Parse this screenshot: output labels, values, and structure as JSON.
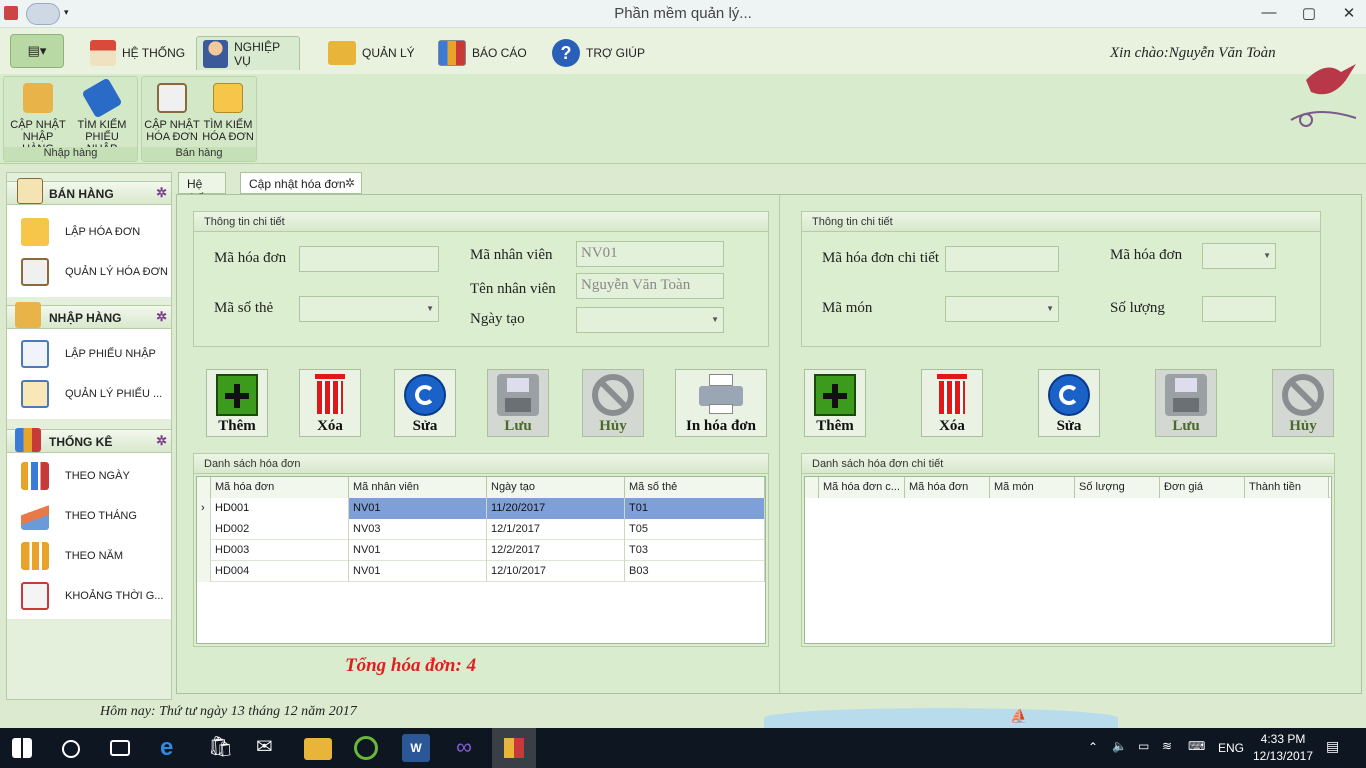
{
  "window": {
    "title": "Phần mềm quản lý..."
  },
  "ribbon_tabs": [
    {
      "label": "HỆ THỐNG"
    },
    {
      "label": "NGHIỆP VỤ"
    },
    {
      "label": "QUẢN LÝ"
    },
    {
      "label": "BÁO CÁO"
    },
    {
      "label": "TRỢ GIÚP"
    }
  ],
  "greeting": "Xin chào:Nguyễn Văn Toàn",
  "ribbon_groups": [
    {
      "label": "Nhập hàng",
      "buttons": [
        {
          "line1": "CẬP NHẬT",
          "line2": "NHẬP HÀNG"
        },
        {
          "line1": "TÌM KIẾM",
          "line2": "PHIẾU NHẬP"
        }
      ]
    },
    {
      "label": "Bán hàng",
      "buttons": [
        {
          "line1": "CẬP NHẬT",
          "line2": "HÓA ĐƠN"
        },
        {
          "line1": "TÌM KIẾM",
          "line2": "HÓA ĐƠN"
        }
      ]
    }
  ],
  "nav": {
    "sections": [
      {
        "title": "BÁN HÀNG",
        "items": [
          "LẬP HÓA ĐƠN",
          "QUẢN LÝ HÓA ĐƠN"
        ]
      },
      {
        "title": "NHẬP HÀNG",
        "items": [
          "LẬP PHIẾU NHẬP",
          "QUẢN LÝ PHIẾU ..."
        ]
      },
      {
        "title": "THỐNG KÊ",
        "items": [
          "THEO NGÀY",
          "THEO THÁNG",
          "THEO NĂM",
          "KHOẢNG THỜI G..."
        ]
      }
    ]
  },
  "doc_tabs": [
    "Hệ thống",
    "Cập nhật hóa đơn"
  ],
  "left_form": {
    "group_title": "Thông tin chi tiết",
    "ma_hoa_don_label": "Mã hóa đơn",
    "ma_so_the_label": "Mã số thẻ",
    "ma_nhan_vien_label": "Mã nhân viên",
    "ma_nhan_vien_value": "NV01",
    "ten_nhan_vien_label": "Tên nhân viên",
    "ten_nhan_vien_value": "Nguyễn Văn Toàn",
    "ngay_tao_label": "Ngày tạo"
  },
  "right_form": {
    "group_title": "Thông tin chi tiết",
    "ma_hdct_label": "Mã hóa đơn chi tiết",
    "ma_hoa_don_label": "Mã hóa đơn",
    "ma_mon_label": "Mã món",
    "so_luong_label": "Số lượng"
  },
  "left_buttons": [
    "Thêm",
    "Xóa",
    "Sửa",
    "Lưu",
    "Hủy",
    "In hóa đơn"
  ],
  "right_buttons": [
    "Thêm",
    "Xóa",
    "Sửa",
    "Lưu",
    "Hủy"
  ],
  "invoice_list": {
    "title": "Danh sách hóa đơn",
    "columns": [
      "Mã hóa đơn",
      "Mã nhân viên",
      "Ngày tạo",
      "Mã số thẻ"
    ],
    "rows": [
      [
        "HD001",
        "NV01",
        "11/20/2017",
        "T01"
      ],
      [
        "HD002",
        "NV03",
        "12/1/2017",
        "T05"
      ],
      [
        "HD003",
        "NV01",
        "12/2/2017",
        "T03"
      ],
      [
        "HD004",
        "NV01",
        "12/10/2017",
        "B03"
      ]
    ]
  },
  "detail_list": {
    "title": "Danh sách hóa đơn chi tiết",
    "columns": [
      "Mã hóa đơn c...",
      "Mã hóa đơn",
      "Mã món",
      "Số lượng",
      "Đơn giá",
      "Thành tiền"
    ]
  },
  "total": "Tổng hóa đơn: 4",
  "today": "Hôm nay: Thứ tư ngày 13 tháng 12 năm 2017",
  "taskbar": {
    "lang": "ENG",
    "time": "4:33 PM",
    "date": "12/13/2017"
  },
  "colors": {
    "selected_row": "#7f9fd8",
    "total_text": "#e02020",
    "add_green": "#3c9a1c",
    "delete_red": "#e01818",
    "edit_blue": "#1a62c8"
  }
}
